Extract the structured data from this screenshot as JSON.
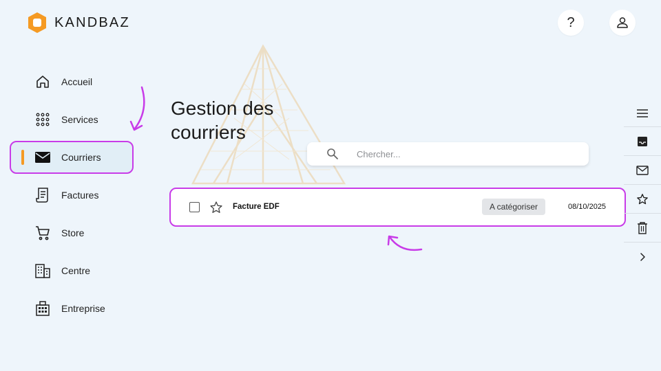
{
  "app": {
    "name": "KANDBAZ",
    "brand_color": "#f59a23",
    "highlight_color": "#c83be8"
  },
  "header": {
    "help_label": "?",
    "help_icon": "question-icon",
    "profile_icon": "user-icon"
  },
  "sidebar": {
    "items": [
      {
        "label": "Accueil",
        "icon": "home-icon"
      },
      {
        "label": "Services",
        "icon": "grid-dots-icon"
      },
      {
        "label": "Courriers",
        "icon": "mail-icon",
        "active": true
      },
      {
        "label": "Factures",
        "icon": "invoice-icon"
      },
      {
        "label": "Store",
        "icon": "cart-icon"
      },
      {
        "label": "Centre",
        "icon": "building-icon"
      },
      {
        "label": "Entreprise",
        "icon": "company-icon"
      }
    ]
  },
  "main": {
    "title": "Gestion des courriers",
    "search": {
      "placeholder": "Chercher...",
      "value": ""
    },
    "mails": [
      {
        "subject": "Facture EDF",
        "category": "A catégoriser",
        "date": "08/10/2025",
        "starred": false,
        "checked": false
      }
    ]
  },
  "right_toolbar": {
    "items": [
      "menu-icon",
      "inbox-icon",
      "mail-icon",
      "star-icon",
      "trash-icon",
      "chevron-right-icon"
    ]
  }
}
